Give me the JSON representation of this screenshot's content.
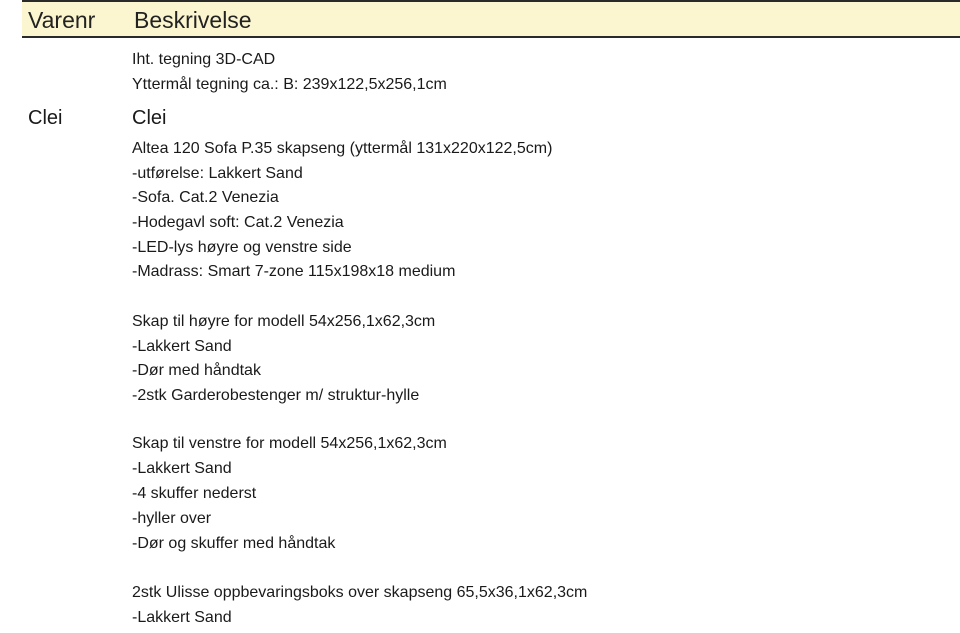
{
  "table": {
    "header": {
      "varenr": "Varenr",
      "beskrivelse": "Beskrivelse"
    },
    "intro_lines": [
      "Iht. tegning 3D-CAD",
      "Yttermål tegning ca.: B: 239x122,5x256,1cm"
    ],
    "item": {
      "varenr": "Clei",
      "title": "Clei"
    },
    "lines": [
      "Altea 120 Sofa P.35 skapseng (yttermål 131x220x122,5cm)",
      "-utførelse: Lakkert Sand",
      "-Sofa. Cat.2 Venezia",
      "-Hodegavl soft: Cat.2 Venezia",
      "-LED-lys høyre og venstre side",
      "-Madrass: Smart 7-zone 115x198x18 medium",
      "Skap til høyre for modell 54x256,1x62,3cm",
      "-Lakkert Sand",
      "-Dør med håndtak",
      "-2stk Garderobestenger m/ struktur-hylle",
      "Skap til venstre for modell 54x256,1x62,3cm",
      "-Lakkert Sand",
      "-4 skuffer nederst",
      "-hyller over",
      "-Dør og skuffer med håndtak",
      "2stk Ulisse oppbevaringsboks over skapseng 65,5x36,1x62,3cm",
      "-Lakkert Sand"
    ]
  }
}
